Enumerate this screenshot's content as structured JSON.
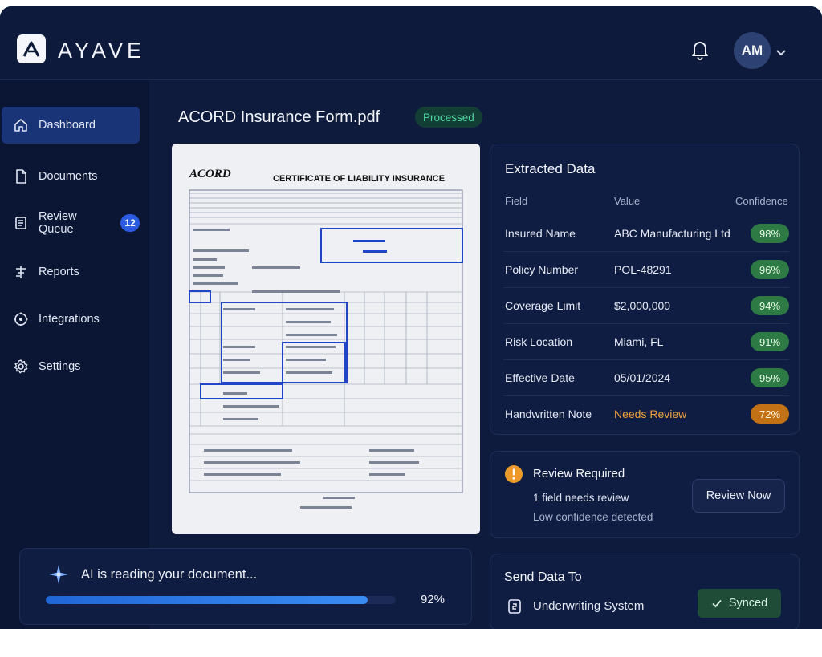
{
  "brand": {
    "name": "AYAVE"
  },
  "header": {
    "avatar_initials": "AM"
  },
  "sidebar": {
    "items": [
      {
        "label": "Dashboard",
        "icon": "home-icon",
        "active": true
      },
      {
        "label": "Documents",
        "icon": "document-icon"
      },
      {
        "label": "Review Queue",
        "icon": "queue-icon",
        "badge": "12"
      },
      {
        "label": "Reports",
        "icon": "reports-icon"
      },
      {
        "label": "Integrations",
        "icon": "integrations-icon"
      },
      {
        "label": "Settings",
        "icon": "gear-icon"
      }
    ]
  },
  "document": {
    "filename": "ACORD Insurance Form.pdf",
    "status": "Processed",
    "preview": {
      "logo": "ACORD",
      "heading": "CERTIFICATE OF LIABILITY INSURANCE"
    }
  },
  "extracted": {
    "title": "Extracted Data",
    "columns": {
      "field": "Field",
      "value": "Value",
      "confidence": "Confidence"
    },
    "rows": [
      {
        "field": "Insured Name",
        "value": "ABC Manufacturing Ltd",
        "confidence": "98%"
      },
      {
        "field": "Policy Number",
        "value": "POL-48291",
        "confidence": "96%"
      },
      {
        "field": "Coverage Limit",
        "value": "$2,000,000",
        "confidence": "94%"
      },
      {
        "field": "Risk Location",
        "value": "Miami, FL",
        "confidence": "91%"
      },
      {
        "field": "Effective Date",
        "value": "05/01/2024",
        "confidence": "95%"
      },
      {
        "field": "Handwritten Note",
        "value": "Needs Review",
        "confidence": "72%",
        "status": "warning"
      }
    ]
  },
  "review": {
    "title": "Review Required",
    "line1": "1 field needs review",
    "line2": "Low confidence detected",
    "button": "Review Now"
  },
  "send": {
    "title": "Send Data To",
    "target": "Underwriting System",
    "status": "Synced"
  },
  "ai": {
    "message": "AI is reading your document...",
    "progress": 0.92,
    "progress_label": "92%"
  },
  "colors": {
    "background": "#0b1736",
    "accent": "#2b5be0",
    "success": "#2e7a45",
    "warning": "#c27215"
  }
}
